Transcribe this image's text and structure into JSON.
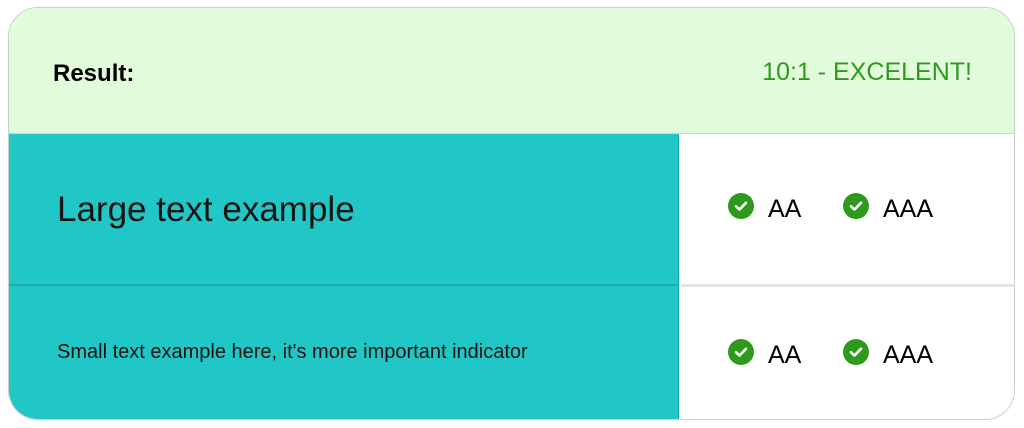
{
  "result": {
    "label": "Result:",
    "value": "10:1 - EXCELENT!",
    "value_color": "#2e9a1c",
    "background_color": "#e2fcdb"
  },
  "preview": {
    "background_color": "#21c7c6",
    "large_text": "Large text example",
    "small_text": "Small text example here, it's more important indicator"
  },
  "ratings": {
    "large": [
      {
        "label": "AA",
        "icon": "check-circle-icon",
        "passed": true
      },
      {
        "label": "AAA",
        "icon": "check-circle-icon",
        "passed": true
      }
    ],
    "small": [
      {
        "label": "AA",
        "icon": "check-circle-icon",
        "passed": true
      },
      {
        "label": "AAA",
        "icon": "check-circle-icon",
        "passed": true
      }
    ]
  }
}
